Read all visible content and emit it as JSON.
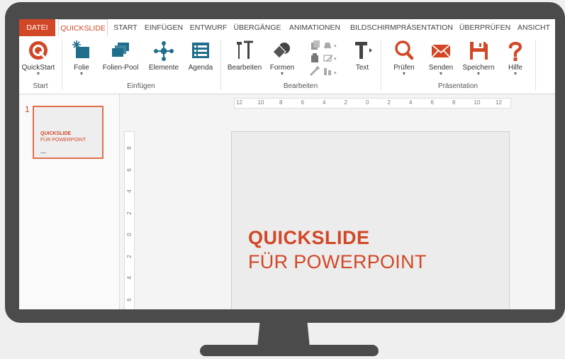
{
  "tabs": {
    "file": "DATEI",
    "quickslide": "QUICKSLIDE",
    "start": "START",
    "einfuegen": "EINFÜGEN",
    "entwurf": "ENTWURF",
    "uebergaenge": "ÜBERGÄNGE",
    "animationen": "ANIMATIONEN",
    "bildschirm": "BILDSCHIRMPRÄSENTATION",
    "ueberpruefen": "ÜBERPRÜFEN",
    "ansicht": "ANSICHT"
  },
  "ribbon": {
    "quickstart": "QuickStart",
    "folie": "Folie",
    "folienpool": "Folien-Pool",
    "elemente": "Elemente",
    "agenda": "Agenda",
    "bearbeiten": "Bearbeiten",
    "formen": "Formen",
    "text": "Text",
    "pruefen": "Prüfen",
    "senden": "Senden",
    "speichern": "Speichern",
    "hilfe": "Hilfe"
  },
  "groups": {
    "start": "Start",
    "einfuegen": "Einfügen",
    "bearbeiten": "Bearbeiten",
    "praesentation": "Präsentation"
  },
  "thumbnail": {
    "number": "1",
    "title_line1": "QUICKSLIDE",
    "title_line2": "FÜR POWERPOINT"
  },
  "slide": {
    "title_line1": "QUICKSLIDE",
    "title_line2": "FÜR POWERPOINT"
  },
  "ruler": {
    "h": [
      "12",
      "10",
      "8",
      "6",
      "4",
      "2",
      "0",
      "2",
      "4",
      "6",
      "8",
      "10",
      "12"
    ],
    "v": [
      "8",
      "6",
      "4",
      "2",
      "0",
      "2",
      "4",
      "6"
    ]
  },
  "colors": {
    "accent": "#d24726",
    "teal": "#1f6e8c",
    "frame": "#4b4b4b"
  },
  "icons": {
    "quickstart": "quickslide-logo-icon",
    "folie": "new-slide-icon",
    "folienpool": "slide-pool-icon",
    "elemente": "elements-icon",
    "agenda": "agenda-list-icon",
    "bearbeiten": "tools-icon",
    "formen": "shapes-icon",
    "text": "text-icon",
    "pruefen": "magnifier-icon",
    "senden": "mail-icon",
    "speichern": "save-icon",
    "hilfe": "help-icon"
  }
}
